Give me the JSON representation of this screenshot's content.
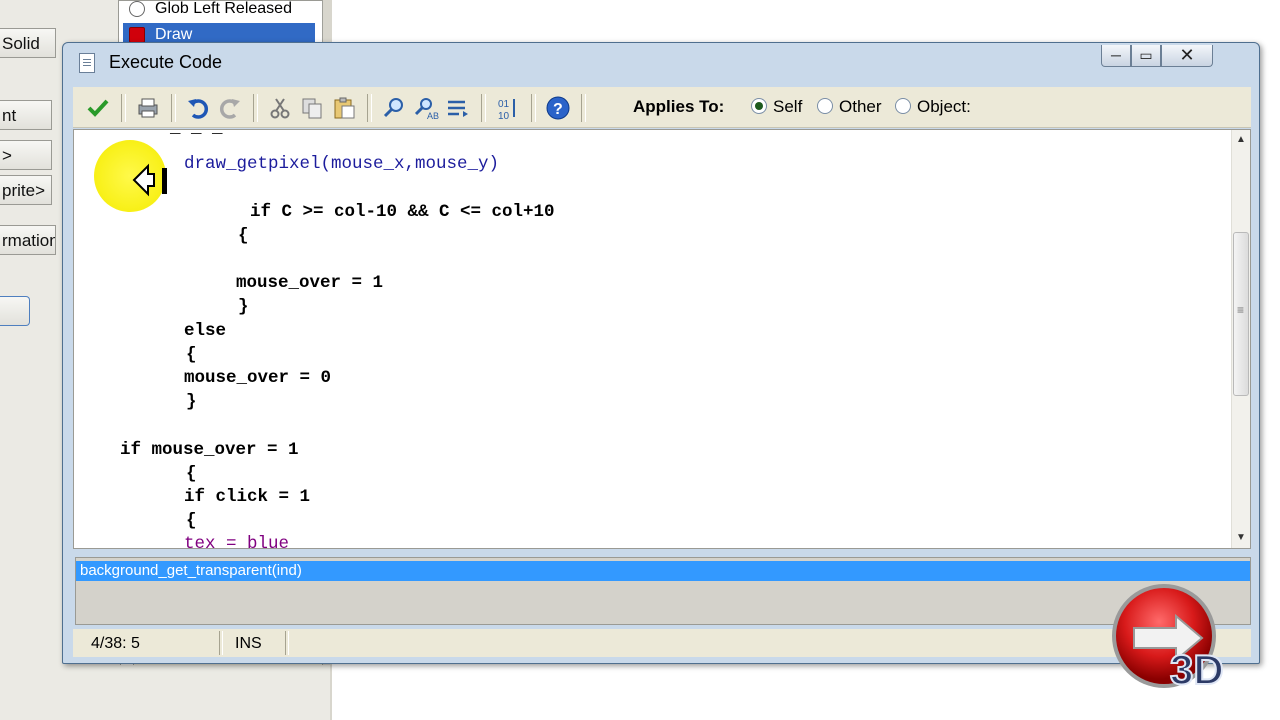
{
  "background": {
    "left_items": [
      "Solid",
      "nt",
      ">",
      "prite>",
      "rmation"
    ],
    "events": [
      "Glob Left Released",
      "Draw"
    ]
  },
  "window": {
    "title": "Execute Code",
    "caption_buttons": {
      "minimize": "─",
      "maximize": "▭",
      "close": "✕"
    }
  },
  "toolbar": {
    "applies_to_label": "Applies To:",
    "options": [
      {
        "label": "Self",
        "checked": true
      },
      {
        "label": "Other",
        "checked": false
      },
      {
        "label": "Object:",
        "checked": false
      }
    ]
  },
  "code": {
    "line_partial_top": "_ _ _",
    "line_getpixel": "draw_getpixel(mouse_x,mouse_y)",
    "line_if_c": "if C >= col-10 && C <= col+10",
    "line_open1": "{",
    "line_mouse_over_1": "mouse_over = 1",
    "line_close1": "}",
    "line_else": "else",
    "line_open2": "{",
    "line_mouse_over_0": "mouse_over = 0",
    "line_close2": "}",
    "line_if_mouse": "if mouse_over = 1",
    "line_open3": "{",
    "line_if_click": "if click = 1",
    "line_open4": "{",
    "line_tex": "tex = blue"
  },
  "hint": {
    "selected": "background_get_transparent(ind)"
  },
  "status": {
    "position": "4/38:  5",
    "mode": "INS"
  },
  "logo": {
    "text": "3D"
  },
  "colors": {
    "selection": "#3399ff",
    "keyword_function": "#1c1c9c",
    "variable": "#800080",
    "highlight_circle": "#f5ec00"
  }
}
